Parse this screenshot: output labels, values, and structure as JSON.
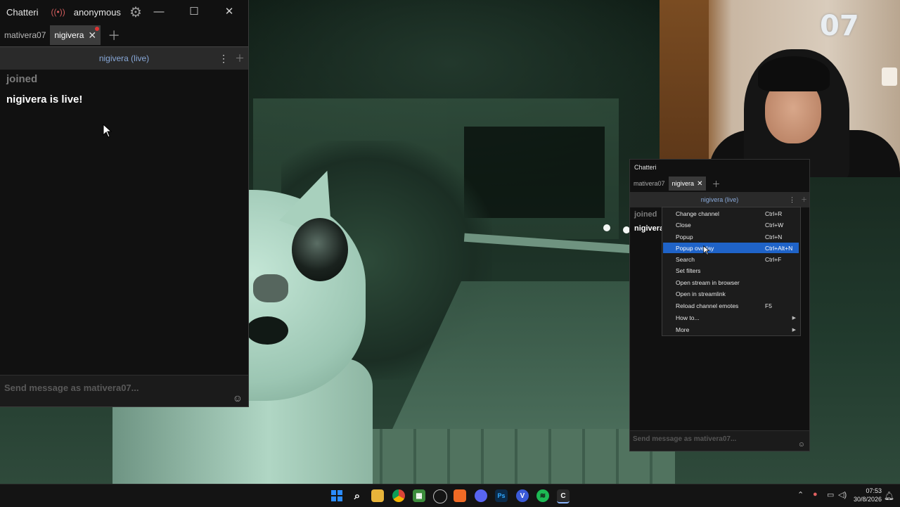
{
  "main_window": {
    "app_name": "Chatteri",
    "account": "anonymous",
    "tabs": [
      {
        "label": "mativera07",
        "active": false
      },
      {
        "label": "nigivera",
        "active": true
      }
    ],
    "split_title": "nigivera (live)",
    "messages": [
      "joined",
      "nigivera is live!"
    ],
    "input_placeholder": "Send message as mativera07..."
  },
  "overlay_window": {
    "app_name": "Chatteri",
    "tabs": [
      {
        "label": "mativera07",
        "active": false
      },
      {
        "label": "nigivera",
        "active": true
      }
    ],
    "split_title": "nigivera (live)",
    "messages": [
      "joined",
      "nigivera"
    ],
    "input_placeholder": "Send message as mativera07..."
  },
  "context_menu": {
    "items": [
      {
        "label": "Change channel",
        "shortcut": "Ctrl+R"
      },
      {
        "label": "Close",
        "shortcut": "Ctrl+W"
      },
      {
        "label": "Popup",
        "shortcut": "Ctrl+N"
      },
      {
        "label": "Popup overlay",
        "shortcut": "Ctrl+Alt+N",
        "highlighted": true
      },
      {
        "label": "Search",
        "shortcut": "Ctrl+F"
      },
      {
        "label": "Set filters",
        "shortcut": ""
      },
      {
        "label": "Open stream in browser",
        "shortcut": ""
      },
      {
        "label": "Open in streamlink",
        "shortcut": ""
      },
      {
        "label": "Reload channel emotes",
        "shortcut": "F5"
      },
      {
        "label": "How to...",
        "shortcut": "",
        "submenu": true
      },
      {
        "label": "More",
        "shortcut": "",
        "submenu": true
      }
    ]
  },
  "webcam": {
    "overlay_text": "07"
  },
  "taskbar": {
    "apps": [
      {
        "name": "start-icon",
        "glyph": "⊞",
        "color": "#2b8cff"
      },
      {
        "name": "search-icon",
        "glyph": "⌕",
        "color": "#141414"
      },
      {
        "name": "file-explorer-icon",
        "glyph": "▆",
        "color": "#e8b43a"
      },
      {
        "name": "chrome-icon",
        "glyph": "◉",
        "color": "#db4437"
      },
      {
        "name": "minecraft-icon",
        "glyph": "▦",
        "color": "#3c8c3c"
      },
      {
        "name": "obs-icon",
        "glyph": "◍",
        "color": "#2a2a2a"
      },
      {
        "name": "brave-icon",
        "glyph": "◆",
        "color": "#f06a25"
      },
      {
        "name": "discord-icon",
        "glyph": "◕",
        "color": "#5865f2"
      },
      {
        "name": "photoshop-icon",
        "glyph": "Ps",
        "color": "#0b2b4a"
      },
      {
        "name": "vpn-icon",
        "glyph": "V",
        "color": "#3a5ad8"
      },
      {
        "name": "spotify-icon",
        "glyph": "≋",
        "color": "#1db954"
      },
      {
        "name": "chatterino-icon",
        "glyph": "C",
        "color": "#2a2a2a"
      }
    ],
    "time": "07:53",
    "date": "30/8/2026"
  }
}
